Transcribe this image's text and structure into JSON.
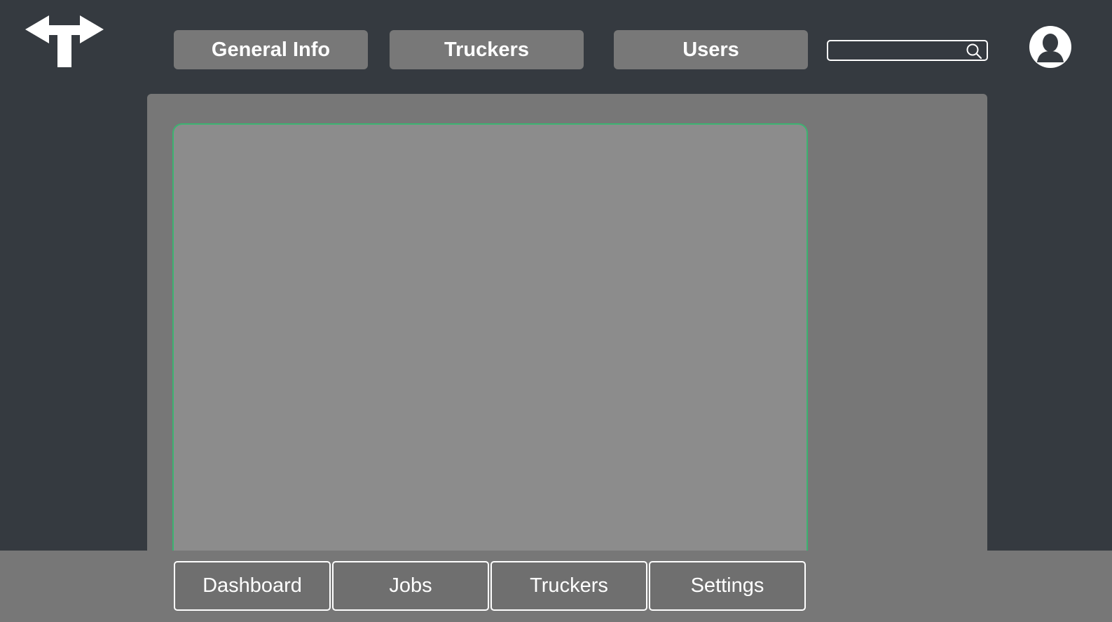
{
  "header": {
    "logo_icon": "double-arrow-t-logo-icon",
    "tabs": [
      {
        "label": "General Info"
      },
      {
        "label": "Truckers"
      },
      {
        "label": "Users"
      }
    ],
    "search": {
      "value": "",
      "placeholder": "",
      "icon": "search-icon"
    },
    "avatar_icon": "user-avatar-icon"
  },
  "bottom_nav": {
    "items": [
      {
        "label": "Dashboard"
      },
      {
        "label": "Jobs"
      },
      {
        "label": "Truckers"
      },
      {
        "label": "Settings"
      }
    ]
  },
  "colors": {
    "background": "#353a40",
    "panel": "#777777",
    "card": "#8c8c8c",
    "card_border": "#3cb371",
    "tab": "#787878",
    "text": "#ffffff"
  }
}
